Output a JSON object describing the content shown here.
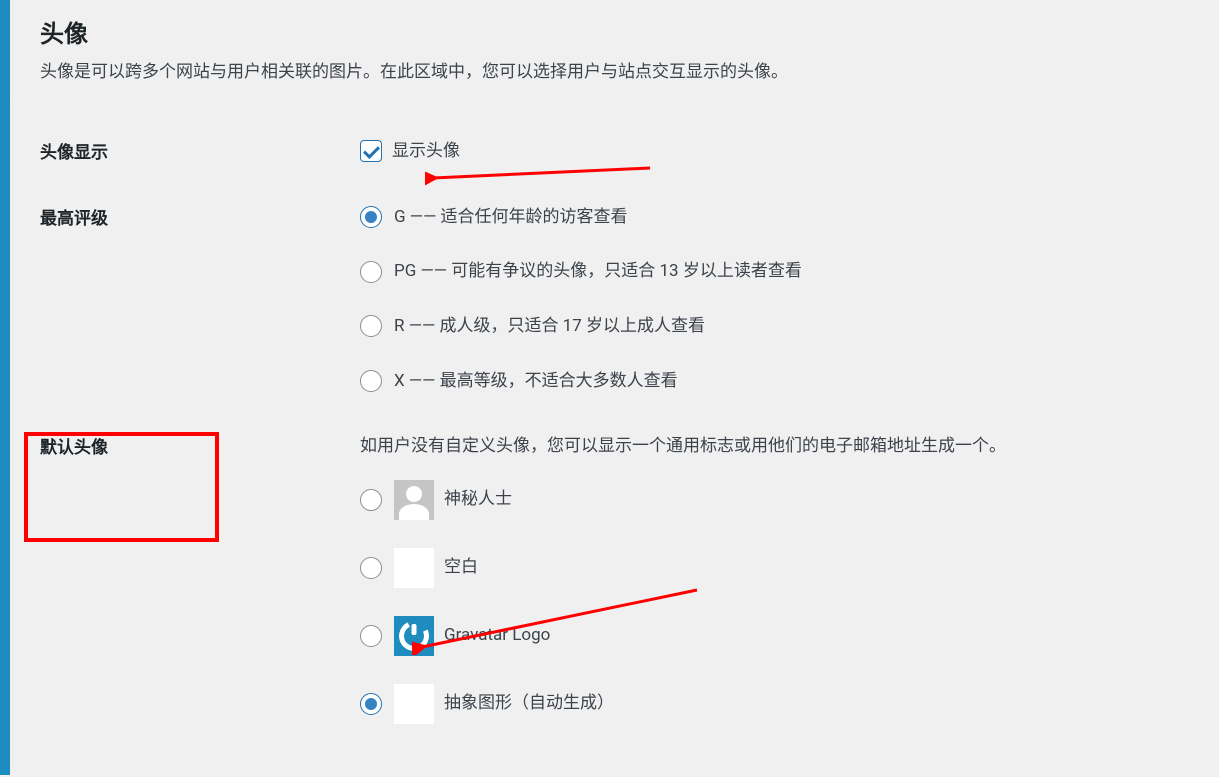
{
  "section": {
    "title": "头像",
    "description": "头像是可以跨多个网站与用户相关联的图片。在此区域中，您可以选择用户与站点交互显示的头像。"
  },
  "avatar_display": {
    "label": "头像显示",
    "checkbox_label": "显示头像",
    "checked": true
  },
  "rating": {
    "label": "最高评级",
    "options": [
      {
        "text": "G —— 适合任何年龄的访客查看",
        "checked": true
      },
      {
        "text": "PG —— 可能有争议的头像，只适合 13 岁以上读者查看",
        "checked": false
      },
      {
        "text": "R —— 成人级，只适合 17 岁以上成人查看",
        "checked": false
      },
      {
        "text": "X —— 最高等级，不适合大多数人查看",
        "checked": false
      }
    ]
  },
  "default_avatar": {
    "label": "默认头像",
    "description": "如用户没有自定义头像，您可以显示一个通用标志或用他们的电子邮箱地址生成一个。",
    "options": [
      {
        "text": "神秘人士",
        "checked": false,
        "kind": "mystery"
      },
      {
        "text": "空白",
        "checked": false,
        "kind": "blank"
      },
      {
        "text": "Gravatar Logo",
        "checked": false,
        "kind": "gravatar"
      },
      {
        "text": "抽象图形（自动生成）",
        "checked": true,
        "kind": "identicon"
      }
    ]
  }
}
